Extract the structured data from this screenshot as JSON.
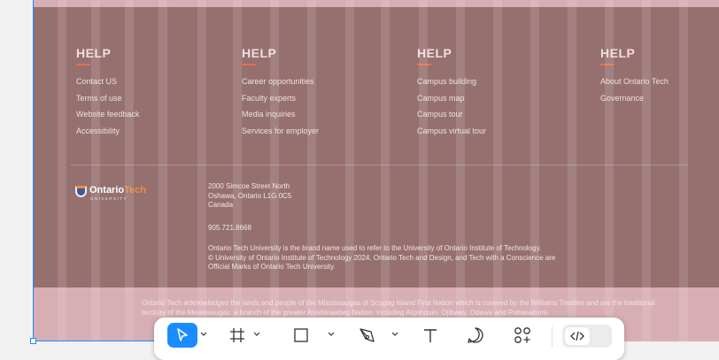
{
  "footer": {
    "columns": [
      {
        "heading": "HELP",
        "links": [
          "Contact US",
          "Terms of use",
          "Website feedback",
          "Accessibility"
        ]
      },
      {
        "heading": "HELP",
        "links": [
          "Career opportunities",
          "Faculty experts",
          "Media inquiries",
          "Services for employer"
        ]
      },
      {
        "heading": "HELP",
        "links": [
          "Campus building",
          "Campus map",
          "Campus tour",
          "Campus virtual tour"
        ]
      },
      {
        "heading": "HELP",
        "links": [
          "About Ontario Tech",
          "Governance"
        ]
      }
    ],
    "logo": {
      "name_part1": "Ontario",
      "name_part2": "Tech",
      "sub": "UNIVERSITY"
    },
    "address": {
      "line1": "2000 Simcoe Street North",
      "line2": "Oshawa, Ontario L1G 0C5",
      "line3": "Canada"
    },
    "phone": "905.721.8668",
    "legal": {
      "line1": "Ontario Tech University is the brand name used to refer to the University of Ontario Institute of Technology.",
      "line2": "© University of Ontario Institute of Technology 2024. Ontario Tech and Design, and Tech with a Conscience are",
      "line3": "Official Marks of Ontario Tech University."
    },
    "acknowledgement": "Ontario Tech acknowledges the lands and people of the Mississaugas of Scugog Island First Nation which is covered by the Williams Treaties and are the traditional territory of the Mississaugas, a branch of the greater Anishinaabeg Nation, including Algonquin, Ojibway, Odawa and Pottawatomi."
  },
  "toolbar": {
    "tools": [
      "move-tool",
      "frame-tool",
      "shape-tool",
      "pen-tool",
      "text-tool",
      "comment-tool",
      "actions-tool"
    ],
    "active_tool": "move-tool",
    "dev_mode_icon": "code-icon"
  },
  "colors": {
    "frame_bg": "#d7aeb4",
    "footer_bg": "#96706f",
    "accent": "#e8704e",
    "selection": "#1b8cff"
  }
}
